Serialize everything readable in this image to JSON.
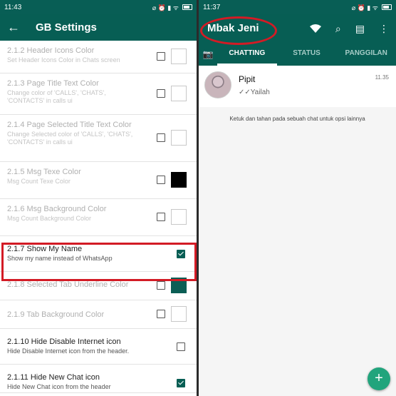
{
  "left": {
    "status": {
      "time": "11:43",
      "icons": "⌀ ⏰ ▮ ᯤ"
    },
    "appbar": {
      "back": "←",
      "title": "GB Settings"
    },
    "rows": [
      {
        "title": "2.1.2 Header Icons Color",
        "subtitle": "Set Header Icons Color in Chats screen",
        "checked": false,
        "swatch": "#ffffff"
      },
      {
        "title": "2.1.3 Page Title Text Color",
        "subtitle": "Change color of 'CALLS', 'CHATS', 'CONTACTS' in calls ui",
        "checked": false,
        "swatch": "#ffffff"
      },
      {
        "title": "2.1.4 Page Selected Title Text Color",
        "subtitle": "Change Selected color of 'CALLS', 'CHATS', 'CONTACTS' in calls ui",
        "checked": false,
        "swatch": "#ffffff"
      },
      {
        "title": "2.1.5 Msg Texe Color",
        "subtitle": "Msg Count Texe Color",
        "checked": false,
        "swatch": "#000000"
      },
      {
        "title": "2.1.6 Msg Background Color",
        "subtitle": "Msg Count Background Color",
        "checked": false,
        "swatch": "#ffffff"
      },
      {
        "title": "2.1.7 Show My Name",
        "subtitle": "Show my name instead of WhatsApp",
        "checked": true,
        "swatch": ""
      },
      {
        "title": "2.1.8 Selected Tab Underline Color",
        "subtitle": "",
        "checked": false,
        "swatch": "#0b5e55"
      },
      {
        "title": "2.1.9 Tab Background Color",
        "subtitle": "",
        "checked": false,
        "swatch": "#ffffff"
      },
      {
        "title": "2.1.10 Hide Disable Internet icon",
        "subtitle": "Hide Disable Internet icon from the header.",
        "checked": false,
        "swatch": ""
      },
      {
        "title": "2.1.11 Hide New Chat icon",
        "subtitle": "Hide New Chat icon from the header",
        "checked": true,
        "swatch": ""
      }
    ]
  },
  "right": {
    "status": {
      "time": "11:37",
      "icons": "⌀ ⏰ ▮ ᯤ"
    },
    "header": {
      "name": "Mbak Jeni",
      "wifi": "wifi-icon",
      "search": "⌕",
      "new_chat": "▤",
      "menu": "⋮"
    },
    "tabs": {
      "camera": "📷",
      "chatting": "CHATTING",
      "status": "STATUS",
      "calls": "PANGGILAN"
    },
    "chat": {
      "name": "Pipit",
      "message": "✓✓Yailah",
      "time": "11.35"
    },
    "hint": "Ketuk dan tahan pada sebuah chat untuk opsi lainnya",
    "fab": "+"
  },
  "colors": {
    "primary": "#075e54",
    "highlight": "#d31b25",
    "fab": "#21a47c"
  }
}
